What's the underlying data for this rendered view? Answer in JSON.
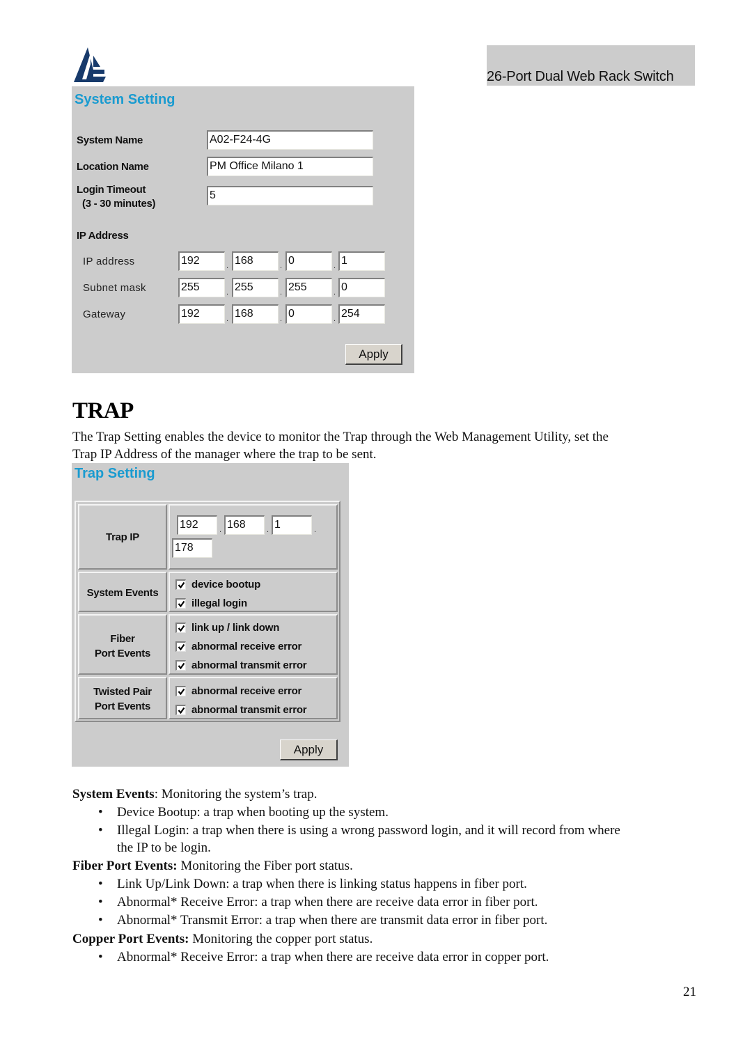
{
  "header": {
    "logo_icon": "atlantis-sail-logo",
    "title": "26-Port Dual Web Rack Switch"
  },
  "system_setting": {
    "title": "System Setting",
    "system_name_label": "System Name",
    "system_name_value": "A02-F24-4G",
    "location_name_label": "Location Name",
    "location_name_value": "PM Office Milano 1",
    "login_timeout_label": "Login Timeout",
    "login_timeout_range": "(3 - 30 minutes)",
    "login_timeout_value": "5",
    "ip_section_label": "IP Address",
    "ip_address_label": "IP address",
    "ip_address": [
      "192",
      "168",
      "0",
      "1"
    ],
    "subnet_mask_label": "Subnet mask",
    "subnet_mask": [
      "255",
      "255",
      "255",
      "0"
    ],
    "gateway_label": "Gateway",
    "gateway": [
      "192",
      "168",
      "0",
      "254"
    ],
    "separator": ".",
    "apply_label": "Apply"
  },
  "section": {
    "heading": "TRAP",
    "intro_line1": "The Trap Setting enables the device to monitor the Trap through the Web Management Utility, set the",
    "intro_line2": "Trap IP Address of the manager where the trap to be sent."
  },
  "trap_setting": {
    "title": "Trap Setting",
    "trap_ip_label": "Trap IP",
    "trap_ip": [
      "192",
      "168",
      "1",
      "178"
    ],
    "separator": ".",
    "system_events_label": "System Events",
    "system_events": [
      {
        "label": "device bootup",
        "checked": true
      },
      {
        "label": "illegal login",
        "checked": true
      }
    ],
    "fiber_label_line1": "Fiber",
    "fiber_label_line2": "Port Events",
    "fiber_events": [
      {
        "label": "link up / link down",
        "checked": true
      },
      {
        "label": "abnormal receive error",
        "checked": true
      },
      {
        "label": "abnormal transmit error",
        "checked": true
      }
    ],
    "twisted_label_line1": "Twisted Pair",
    "twisted_label_line2": "Port Events",
    "twisted_events": [
      {
        "label": "abnormal receive error",
        "checked": true
      },
      {
        "label": "abnormal transmit error",
        "checked": true
      }
    ],
    "apply_label": "Apply"
  },
  "descriptions": {
    "system_events_term": "System Events",
    "system_events_desc": ": Monitoring the system’s trap.",
    "system_bullets": [
      "Device Bootup: a trap when booting up the system.",
      "Illegal Login: a trap when there is using a wrong password login, and it will record from where",
      "the IP to be login."
    ],
    "fiber_term": "Fiber Port Events:",
    "fiber_desc": " Monitoring the Fiber port status.",
    "fiber_bullets": [
      "Link Up/Link Down: a trap when there is linking status happens in fiber port.",
      "Abnormal* Receive Error: a trap when there are receive data error in fiber port.",
      "Abnormal* Transmit Error: a trap when there are transmit data error in fiber port."
    ],
    "copper_term": "Copper Port Events:",
    "copper_desc": " Monitoring the copper port status.",
    "copper_bullets": [
      "Abnormal* Receive Error: a trap when there are receive data error in copper port."
    ],
    "bullet_glyph": "•"
  },
  "footer": {
    "page_number": "21"
  }
}
